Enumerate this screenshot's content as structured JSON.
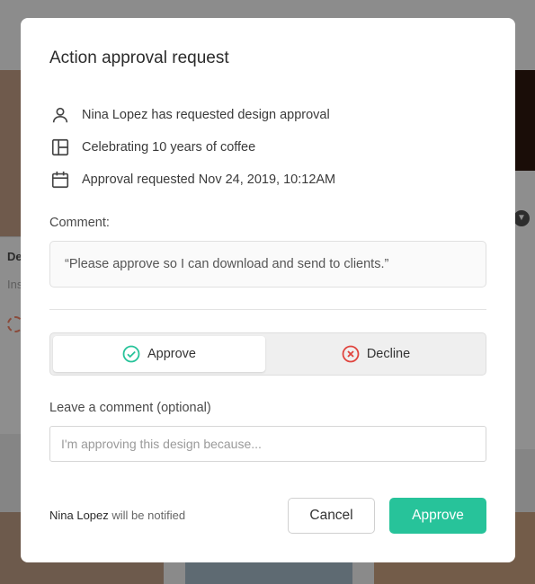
{
  "background": {
    "left_label": "De",
    "left_sub": "Ins"
  },
  "modal": {
    "title": "Action approval request",
    "info": [
      {
        "icon": "user-icon",
        "text": "Nina Lopez has requested design approval"
      },
      {
        "icon": "layout-icon",
        "text": "Celebrating 10 years of coffee"
      },
      {
        "icon": "calendar-icon",
        "text": "Approval requested Nov 24, 2019, 10:12AM"
      }
    ],
    "comment_label": "Comment:",
    "comment_text": "“Please approve so I can download and send to clients.”",
    "decision": {
      "approve_label": "Approve",
      "decline_label": "Decline",
      "selected": "Approve"
    },
    "leave_comment_label": "Leave a comment (optional)",
    "leave_comment_placeholder": "I'm approving this design because...",
    "notify_name": "Nina Lopez",
    "notify_suffix": " will be notified",
    "cancel_label": "Cancel",
    "approve_label": "Approve"
  },
  "colors": {
    "accent": "#27c39a",
    "decline": "#e0443e"
  }
}
